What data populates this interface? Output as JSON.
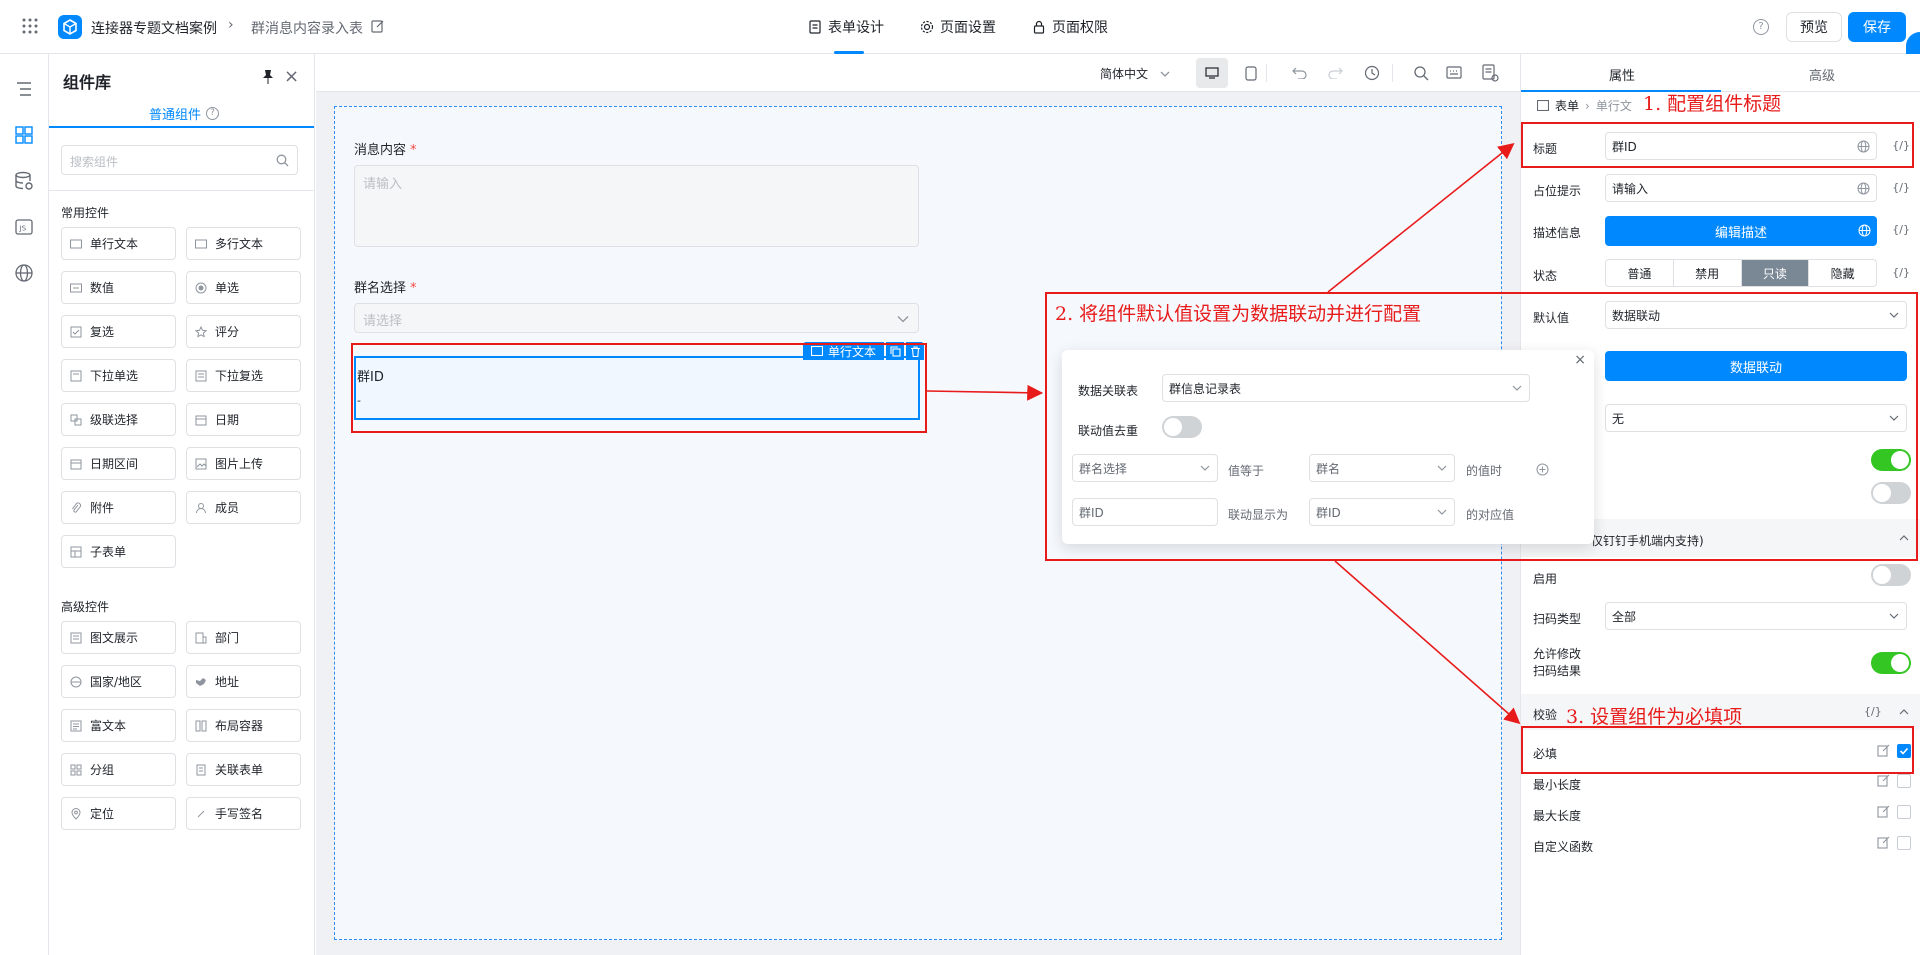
{
  "app": {
    "breadcrumb_app": "连接器专题文档案例",
    "breadcrumb_page": "群消息内容录入表",
    "tabs": [
      "表单设计",
      "页面设置",
      "页面权限"
    ],
    "preview_label": "预览",
    "save_label": "保存",
    "colors": {
      "accent": "#0089ff",
      "annotation": "#e81b1b"
    }
  },
  "library": {
    "title": "组件库",
    "tab": "普通组件",
    "search_placeholder": "搜索组件",
    "common_title": "常用控件",
    "common": [
      "单行文本",
      "多行文本",
      "数值",
      "单选",
      "复选",
      "评分",
      "下拉单选",
      "下拉复选",
      "级联选择",
      "日期",
      "日期区间",
      "图片上传",
      "附件",
      "成员",
      "子表单"
    ],
    "advanced_title": "高级控件",
    "advanced": [
      "图文展示",
      "部门",
      "国家/地区",
      "地址",
      "富文本",
      "布局容器",
      "分组",
      "关联表单",
      "定位",
      "手写签名"
    ]
  },
  "toolbar": {
    "language": "简体中文"
  },
  "form": {
    "field1_label": "消息内容",
    "field1_placeholder": "请输入",
    "field2_label": "群名选择",
    "field2_placeholder": "请选择",
    "field3_label": "群ID",
    "selected_tag": "单行文本"
  },
  "popup": {
    "source_label": "数据关联表",
    "source_value": "群信息记录表",
    "dedupe_label": "联动值去重",
    "cond_field": "群名选择",
    "cond_op": "值等于",
    "cond_target": "群名",
    "cond_suffix": "的值时",
    "show_field": "群ID",
    "show_op": "联动显示为",
    "show_target": "群ID",
    "show_suffix": "的对应值"
  },
  "props": {
    "tab_props": "属性",
    "tab_advanced": "高级",
    "crumb_form": "表单",
    "crumb_item": "单行文",
    "title_label": "标题",
    "title_value": "群ID",
    "placeholder_label": "占位提示",
    "placeholder_value": "请输入",
    "desc_label": "描述信息",
    "desc_button": "编辑描述",
    "state_label": "状态",
    "states": [
      "普通",
      "禁用",
      "只读",
      "隐藏"
    ],
    "state_active": "只读",
    "default_label": "默认值",
    "default_value": "数据联动",
    "linkage_button": "数据联动",
    "none_value": "无",
    "scan_section": "仅钉钉手机端内支持)",
    "enable_label": "启用",
    "scan_type_label": "扫码类型",
    "scan_type_value": "全部",
    "allow_edit_label1": "允许修改",
    "allow_edit_label2": "扫码结果",
    "validate_label": "校验",
    "required_label": "必填",
    "min_label": "最小长度",
    "max_label": "最大长度",
    "custom_label": "自定义函数",
    "fx": "{/}"
  },
  "annotations": {
    "a1": "1. 配置组件标题",
    "a2": "2. 将组件默认值设置为数据联动并进行配置",
    "a3": "3. 设置组件为必填项"
  }
}
